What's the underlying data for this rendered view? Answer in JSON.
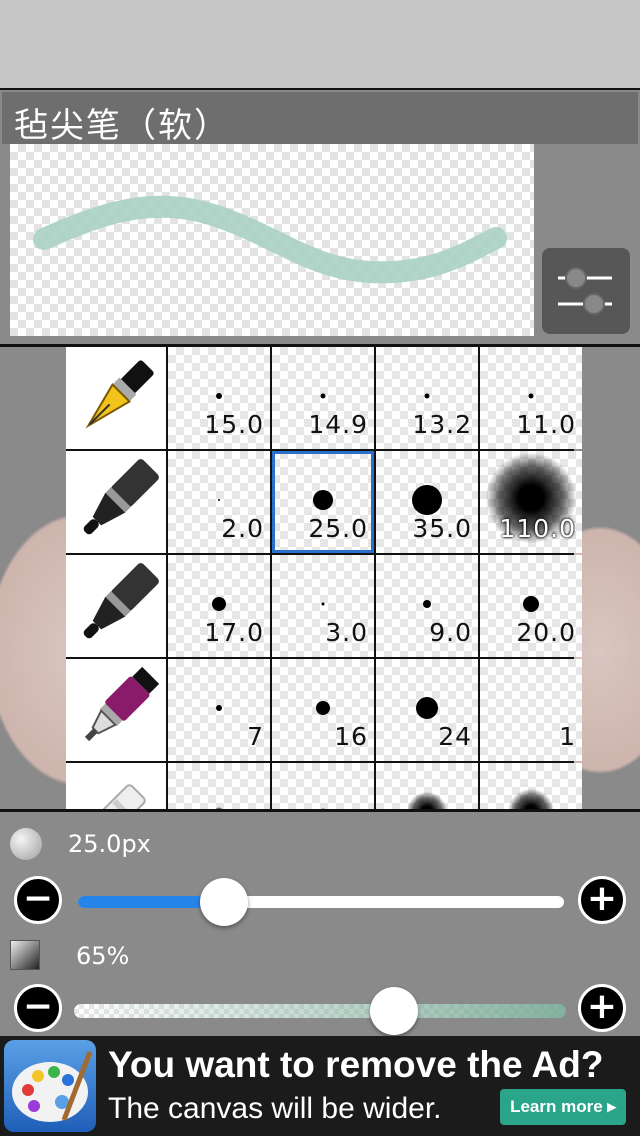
{
  "brush_panel": {
    "title": "毡尖笔（软）",
    "preview_stroke_color": "#a9d2c3",
    "settings_icon": "sliders-icon"
  },
  "brush_grid": {
    "rows": [
      {
        "icon": "fountain-pen-icon",
        "sizes": [
          "15.0",
          "14.9",
          "13.2",
          "11.0"
        ]
      },
      {
        "icon": "felt-pen-icon",
        "sizes": [
          "2.0",
          "25.0",
          "35.0",
          "110.0"
        ]
      },
      {
        "icon": "felt-pen-icon",
        "sizes": [
          "17.0",
          "3.0",
          "9.0",
          "20.0"
        ]
      },
      {
        "icon": "marker-icon",
        "sizes": [
          "7",
          "16",
          "24",
          "1"
        ]
      },
      {
        "icon": "airbrush-icon",
        "sizes": [
          "",
          "",
          "",
          ""
        ]
      }
    ],
    "selected": "25.0"
  },
  "controls": {
    "size_label": "25.0px",
    "size_fraction": 0.3,
    "opacity_label": "65%",
    "opacity_fraction": 0.65,
    "minus": "−",
    "plus": "+"
  },
  "ad": {
    "title": "You want to remove the Ad?",
    "subtitle": "The canvas will be wider.",
    "button": "Learn more ▸",
    "accent": "#2aa58a"
  }
}
